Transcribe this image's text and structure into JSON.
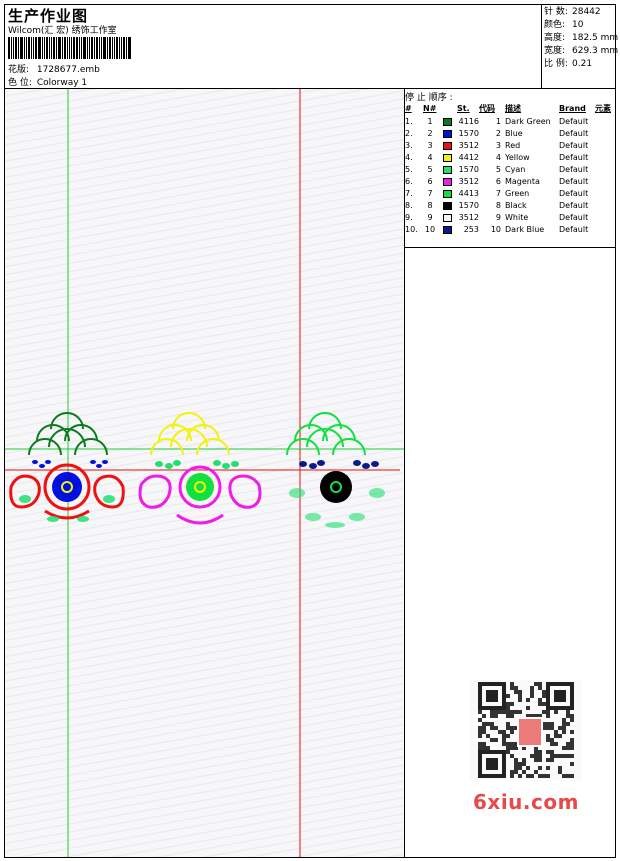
{
  "header": {
    "title": "生产作业图",
    "company": "Wilcom(汇 宏) 绣饰工作室",
    "design_label": "花版:",
    "design_file": "1728677.emb",
    "colorway_label": "色 位:",
    "colorway": "Colorway 1"
  },
  "stats": [
    {
      "label": "针 数:",
      "value": "28442"
    },
    {
      "label": "颜色:",
      "value": "10"
    },
    {
      "label": "高度:",
      "value": "182.5 mm"
    },
    {
      "label": "宽度:",
      "value": "629.3 mm"
    },
    {
      "label": "比 例:",
      "value": "0.21"
    }
  ],
  "stop_sequence": {
    "title": "停 止 顺序 :",
    "columns": [
      "#",
      "N#",
      "St.",
      "代码",
      "描述",
      "Brand",
      "元素"
    ],
    "rows": [
      {
        "idx": "1.",
        "n": "1",
        "st": "4116",
        "code": "1",
        "desc": "Dark Green",
        "brand": "Default",
        "color": "#0b7a1c"
      },
      {
        "idx": "2.",
        "n": "2",
        "st": "1570",
        "code": "2",
        "desc": "Blue",
        "brand": "Default",
        "color": "#0010e0"
      },
      {
        "idx": "3.",
        "n": "3",
        "st": "3512",
        "code": "3",
        "desc": "Red",
        "brand": "Default",
        "color": "#ef1010"
      },
      {
        "idx": "4.",
        "n": "4",
        "st": "4412",
        "code": "4",
        "desc": "Yellow",
        "brand": "Default",
        "color": "#f2f20a"
      },
      {
        "idx": "5.",
        "n": "5",
        "st": "1570",
        "code": "5",
        "desc": "Cyan",
        "brand": "Default",
        "color": "#20e070"
      },
      {
        "idx": "6.",
        "n": "6",
        "st": "3512",
        "code": "6",
        "desc": "Magenta",
        "brand": "Default",
        "color": "#ee1ee8"
      },
      {
        "idx": "7.",
        "n": "7",
        "st": "4413",
        "code": "7",
        "desc": "Green",
        "brand": "Default",
        "color": "#10e040"
      },
      {
        "idx": "8.",
        "n": "8",
        "st": "1570",
        "code": "8",
        "desc": "Black",
        "brand": "Default",
        "color": "#000000"
      },
      {
        "idx": "9.",
        "n": "9",
        "st": "3512",
        "code": "9",
        "desc": "White",
        "brand": "Default",
        "color": "#f4f4f4"
      },
      {
        "idx": "10.",
        "n": "10",
        "st": "253",
        "code": "10",
        "desc": "Dark Blue",
        "brand": "Default",
        "color": "#0a1a8a"
      }
    ]
  },
  "watermark": {
    "logo": "6xiu.com"
  },
  "colors": {
    "guide_green": "#22c838",
    "guide_red": "#e01010"
  }
}
